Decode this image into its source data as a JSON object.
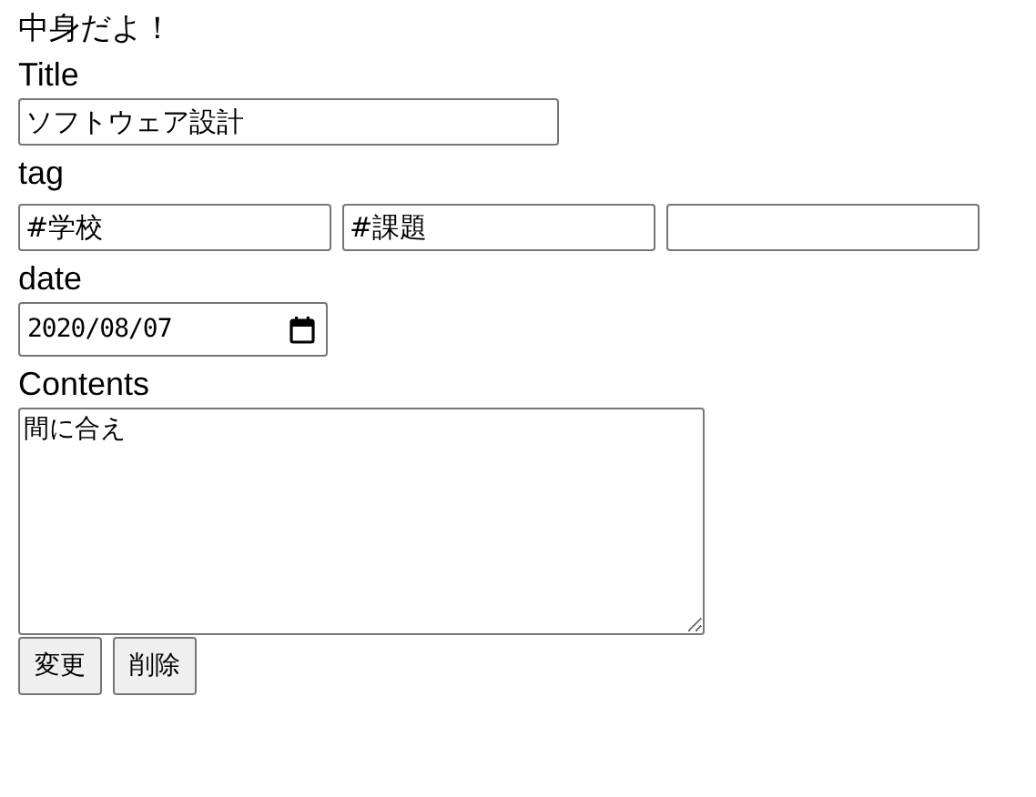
{
  "heading": "中身だよ！",
  "title_field": {
    "label": "Title",
    "value": "ソフトウェア設計"
  },
  "tag_fields": {
    "label": "tag",
    "inputs": [
      {
        "kind": "filled",
        "value": "#学校"
      },
      {
        "kind": "filled",
        "value": "#課題"
      },
      {
        "kind": "empty"
      }
    ]
  },
  "date_field": {
    "label": "date",
    "value": "2020/08/07"
  },
  "contents_field": {
    "label": "Contents",
    "value": "間に合え"
  },
  "buttons": [
    "変更",
    "削除"
  ]
}
